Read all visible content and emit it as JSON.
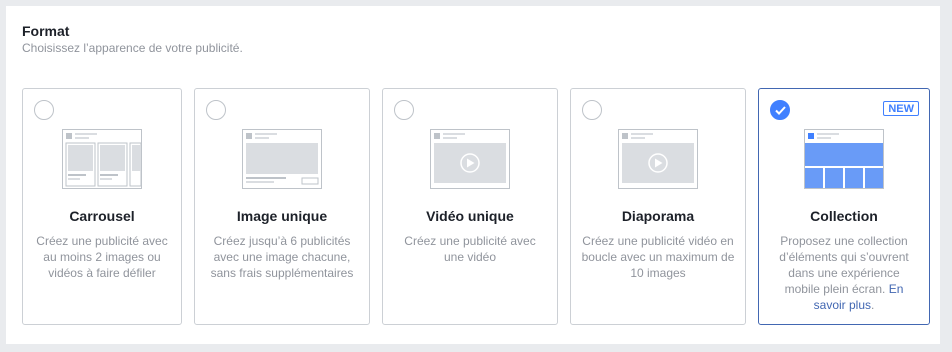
{
  "header": {
    "title": "Format",
    "subtitle": "Choisissez l’apparence de votre publicité."
  },
  "colors": {
    "accent": "#4080ff",
    "selected_border": "#4267b2",
    "muted_text": "#90949c"
  },
  "cards": [
    {
      "title": "Carrousel",
      "description": "Créez une publicité avec au moins 2 images ou vidéos à faire défiler",
      "selected": false,
      "icon": "carousel-preview-icon"
    },
    {
      "title": "Image unique",
      "description": "Créez jusqu’à 6 publicités avec une image chacune, sans frais supplémentaires",
      "selected": false,
      "icon": "single-image-preview-icon"
    },
    {
      "title": "Vidéo unique",
      "description": "Créez une publicité avec une vidéo",
      "selected": false,
      "icon": "single-video-preview-icon"
    },
    {
      "title": "Diaporama",
      "description": "Créez une publicité vidéo en boucle avec un maximum de 10 images",
      "selected": false,
      "icon": "slideshow-preview-icon"
    },
    {
      "title": "Collection",
      "description": "Proposez une collection d’éléments qui s’ouvrent dans une expérience mobile plein écran.",
      "link_text": "En savoir plus",
      "link_suffix": ".",
      "badge": "NEW",
      "selected": true,
      "icon": "collection-preview-icon"
    }
  ]
}
